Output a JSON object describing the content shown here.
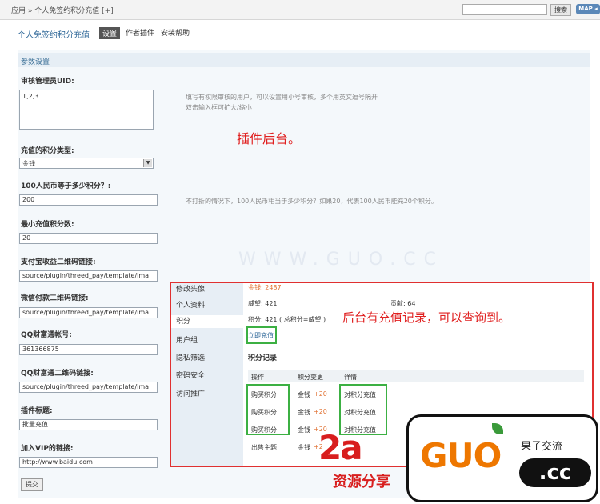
{
  "topbar": {
    "breadcrumb": "应用 » 个人免签约积分充值 [+]",
    "search_button": "搜索",
    "map_button": "MAP ◂"
  },
  "plugin": {
    "title": "个人免签约积分充值",
    "tabs": [
      "设置",
      "作者插件",
      "安装帮助"
    ]
  },
  "section_title": "参数设置",
  "form": {
    "admin_uid": {
      "label": "审核管理员UID:",
      "value": "1,2,3"
    },
    "admin_uid_hint_1": "填写有权限审核的用户，可以设置用小号审核，多个用英文逗号隔开",
    "admin_uid_hint_2": "双击输入框可扩大/缩小",
    "credit_type": {
      "label": "充值的积分类型:",
      "value": "金钱"
    },
    "rate": {
      "label": "100人民币等于多少积分？:",
      "value": "200"
    },
    "rate_hint": "不打折的情况下，100人民币相当于多少积分？如果20，代表100人民币能充20个积分。",
    "min_credit": {
      "label": "最小充值积分数:",
      "value": "20"
    },
    "alipay_qr": {
      "label": "支付宝收益二维码链接:",
      "value": "source/plugin/threed_pay/template/ima"
    },
    "wechat_qr": {
      "label": "微信付款二维码链接:",
      "value": "source/plugin/threed_pay/template/ima"
    },
    "qq_account": {
      "label": "QQ财富通帐号:",
      "value": "361366875"
    },
    "qq_qr": {
      "label": "QQ财富通二维码链接:",
      "value": "source/plugin/threed_pay/template/ima"
    },
    "plugin_title": {
      "label": "插件标题:",
      "value": "批量充值"
    },
    "vip_link": {
      "label": "加入VIP的链接:",
      "value": "http://www.baidu.com"
    },
    "submit": "提交"
  },
  "annotations": {
    "backend": "插件后台。",
    "records": "后台有充值记录，可以查询到。"
  },
  "watermark_url": "WWW.GUO.CC",
  "inset": {
    "sidebar": [
      "修改头像",
      "个人资料",
      "积分",
      "用户组",
      "隐私筛选",
      "密码安全",
      "访问推广"
    ],
    "money_top": "金钱: 2487",
    "prestige": "威望: 421",
    "contribution": "贡献: 64",
    "credits": "积分: 421 ( 总积分=威望 )",
    "recharge_link": "立即充值",
    "records_title": "积分记录",
    "columns": [
      "操作",
      "积分变更",
      "详情"
    ],
    "rows": [
      {
        "action": "购买积分",
        "currency": "金钱",
        "change": "+20",
        "detail": "对积分充值"
      },
      {
        "action": "购买积分",
        "currency": "金钱",
        "change": "+20",
        "detail": "对积分充值"
      },
      {
        "action": "购买积分",
        "currency": "金钱",
        "change": "+20",
        "detail": "对积分充值"
      },
      {
        "action": "出售主题",
        "currency": "金钱",
        "change": "+2",
        "detail": ""
      }
    ]
  },
  "stamp": {
    "big": "2a",
    "sub": "资源分享"
  },
  "logo": {
    "guo": "GUO",
    "cn": "果子交流",
    "cc": ".cc"
  }
}
